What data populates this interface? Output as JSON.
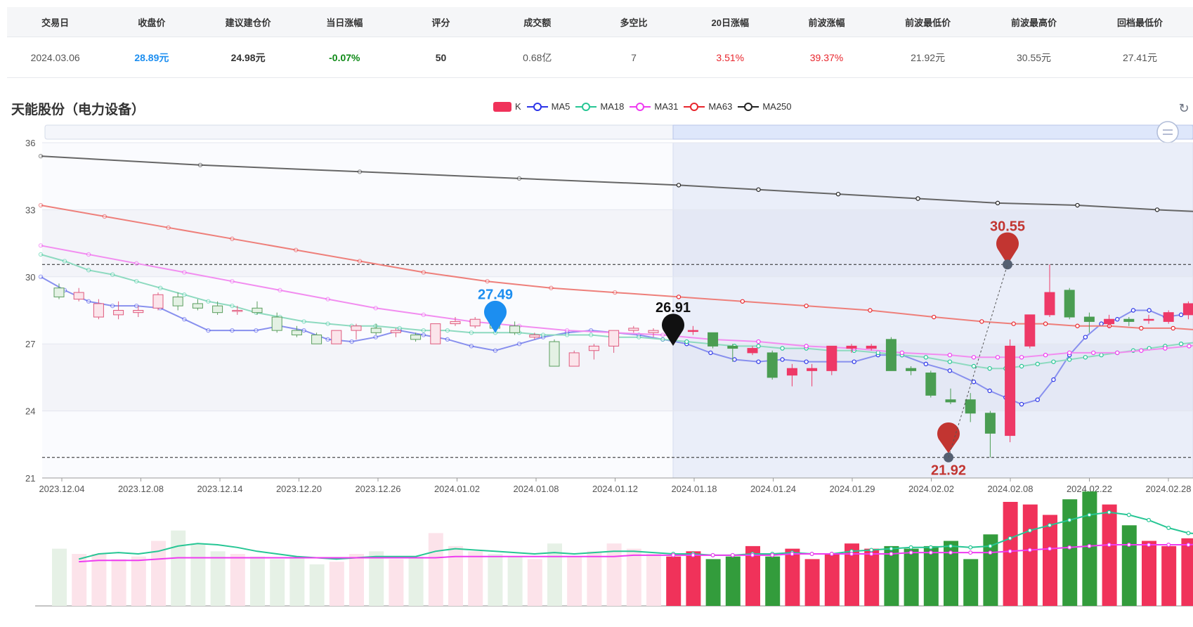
{
  "stats": {
    "headers": [
      "交易日",
      "收盘价",
      "建议建仓价",
      "当日涨幅",
      "评分",
      "成交额",
      "多空比",
      "20日涨幅",
      "前波涨幅",
      "前波最低价",
      "前波最高价",
      "回档最低价"
    ],
    "values": [
      "2024.03.06",
      "28.89元",
      "24.98元",
      "-0.07%",
      "50",
      "0.68亿",
      "7",
      "3.51%",
      "39.37%",
      "21.92元",
      "30.55元",
      "27.41元"
    ],
    "colors": [
      "#555555",
      "#1c8ef0",
      "#333333",
      "#0f8a17",
      "#333333",
      "#555555",
      "#555555",
      "#e8262d",
      "#e8262d",
      "#555555",
      "#555555",
      "#555555"
    ],
    "bold": [
      false,
      true,
      true,
      true,
      true,
      false,
      false,
      false,
      false,
      false,
      false,
      false
    ]
  },
  "chart_title": "天能股份（电力设备）",
  "legend": [
    {
      "name": "K",
      "color": "#f0325a",
      "type": "rect"
    },
    {
      "name": "MA5",
      "color": "#2b34e8",
      "type": "line"
    },
    {
      "name": "MA18",
      "color": "#26c694",
      "type": "line"
    },
    {
      "name": "MA31",
      "color": "#ee3cf0",
      "type": "line"
    },
    {
      "name": "MA63",
      "color": "#e8262d",
      "type": "line"
    },
    {
      "name": "MA250",
      "color": "#222222",
      "type": "line"
    }
  ],
  "chart_data": {
    "type": "candlestick",
    "title": "天能股份（电力设备）",
    "ylim": [
      21,
      36
    ],
    "yticks": [
      36,
      33,
      30,
      27,
      24,
      21
    ],
    "xtick_labels": [
      "2023.12.04",
      "2023.12.08",
      "2023.12.14",
      "2023.12.20",
      "2023.12.26",
      "2024.01.02",
      "2024.01.08",
      "2024.01.12",
      "2024.01.18",
      "2024.01.24",
      "2024.01.29",
      "2024.02.02",
      "2024.02.08",
      "2024.02.22",
      "2024.02.28"
    ],
    "candles": [
      [
        29.5,
        29.1,
        29.7,
        29.0
      ],
      [
        29.0,
        29.3,
        29.5,
        28.9
      ],
      [
        28.2,
        28.8,
        29.0,
        28.1
      ],
      [
        28.3,
        28.5,
        28.9,
        28.1
      ],
      [
        28.4,
        28.5,
        28.7,
        28.2
      ],
      [
        28.6,
        29.2,
        29.3,
        28.5
      ],
      [
        29.1,
        28.7,
        29.3,
        28.5
      ],
      [
        28.8,
        28.6,
        29.0,
        28.5
      ],
      [
        28.7,
        28.4,
        28.9,
        28.3
      ],
      [
        28.5,
        28.5,
        28.7,
        28.3
      ],
      [
        28.6,
        28.4,
        28.9,
        28.3
      ],
      [
        28.2,
        27.6,
        28.4,
        27.5
      ],
      [
        27.6,
        27.4,
        27.8,
        27.3
      ],
      [
        27.4,
        27.0,
        27.5,
        27.0
      ],
      [
        27.0,
        27.6,
        27.6,
        27.0
      ],
      [
        27.6,
        27.8,
        27.9,
        27.2
      ],
      [
        27.7,
        27.5,
        27.9,
        27.4
      ],
      [
        27.5,
        27.6,
        27.7,
        27.3
      ],
      [
        27.4,
        27.2,
        27.5,
        27.1
      ],
      [
        27.0,
        27.9,
        27.9,
        27.0
      ],
      [
        27.9,
        28.0,
        28.2,
        27.8
      ],
      [
        27.8,
        28.1,
        28.2,
        27.7
      ],
      [
        27.9,
        27.7,
        28.1,
        27.6
      ],
      [
        27.8,
        27.5,
        28.0,
        27.4
      ],
      [
        27.3,
        27.4,
        27.5,
        27.2
      ],
      [
        27.1,
        26.0,
        27.2,
        26.0
      ],
      [
        26.0,
        26.6,
        26.7,
        26.0
      ],
      [
        26.7,
        26.9,
        27.0,
        26.3
      ],
      [
        26.9,
        27.6,
        27.6,
        26.6
      ],
      [
        27.6,
        27.7,
        27.8,
        27.5
      ],
      [
        27.5,
        27.6,
        27.7,
        27.3
      ],
      [
        27.4,
        27.5,
        27.6,
        27.3
      ],
      [
        27.6,
        27.6,
        27.8,
        27.4
      ],
      [
        27.5,
        26.9,
        27.5,
        26.8
      ],
      [
        26.9,
        26.8,
        27.0,
        26.2
      ],
      [
        26.6,
        26.8,
        26.9,
        26.5
      ],
      [
        26.6,
        25.5,
        26.7,
        25.4
      ],
      [
        25.6,
        25.9,
        26.1,
        25.1
      ],
      [
        25.8,
        25.9,
        26.1,
        25.1
      ],
      [
        25.8,
        26.9,
        26.9,
        25.6
      ],
      [
        26.8,
        26.9,
        27.0,
        26.6
      ],
      [
        26.8,
        26.9,
        27.0,
        26.7
      ],
      [
        27.2,
        25.8,
        27.3,
        25.8
      ],
      [
        25.9,
        25.8,
        26.0,
        25.6
      ],
      [
        25.7,
        24.7,
        25.8,
        24.6
      ],
      [
        24.5,
        24.4,
        25.0,
        24.3
      ],
      [
        24.5,
        23.9,
        24.8,
        23.5
      ],
      [
        23.9,
        23.0,
        24.0,
        21.92
      ],
      [
        22.9,
        26.9,
        27.2,
        22.6
      ],
      [
        26.9,
        28.3,
        28.3,
        26.8
      ],
      [
        28.3,
        29.3,
        30.55,
        28.2
      ],
      [
        29.4,
        28.2,
        29.5,
        28.1
      ],
      [
        28.2,
        28.0,
        28.4,
        27.5
      ],
      [
        27.9,
        28.1,
        28.3,
        27.7
      ],
      [
        28.1,
        28.0,
        28.2,
        27.8
      ],
      [
        28.1,
        28.1,
        28.3,
        27.9
      ],
      [
        28.0,
        28.4,
        28.5,
        27.9
      ],
      [
        28.3,
        28.8,
        28.9,
        28.1
      ],
      [
        28.8,
        28.0,
        29.4,
        27.9
      ],
      [
        28.0,
        29.2,
        29.3,
        27.9
      ]
    ],
    "ma": {
      "MA5": [
        [
          0,
          30.0
        ],
        [
          3,
          29.4
        ],
        [
          6,
          28.9
        ],
        [
          9,
          28.7
        ],
        [
          12,
          28.7
        ],
        [
          15,
          28.6
        ],
        [
          18,
          28.1
        ],
        [
          21,
          27.6
        ],
        [
          24,
          27.6
        ],
        [
          27,
          27.6
        ],
        [
          30,
          27.8
        ],
        [
          33,
          27.6
        ],
        [
          36,
          27.2
        ],
        [
          39,
          27.1
        ],
        [
          42,
          27.3
        ],
        [
          45,
          27.6
        ],
        [
          48,
          27.4
        ],
        [
          51,
          27.2
        ],
        [
          54,
          26.9
        ],
        [
          57,
          26.7
        ],
        [
          60,
          27.0
        ],
        [
          63,
          27.3
        ],
        [
          66,
          27.5
        ],
        [
          69,
          27.6
        ],
        [
          72,
          27.5
        ],
        [
          75,
          27.4
        ],
        [
          78,
          27.2
        ],
        [
          81,
          27.0
        ],
        [
          84,
          26.6
        ],
        [
          87,
          26.3
        ],
        [
          90,
          26.2
        ],
        [
          93,
          26.3
        ],
        [
          96,
          26.2
        ],
        [
          99,
          26.2
        ],
        [
          102,
          26.2
        ],
        [
          105,
          26.5
        ],
        [
          108,
          26.5
        ],
        [
          111,
          26.1
        ],
        [
          114,
          25.8
        ],
        [
          117,
          25.3
        ],
        [
          119,
          24.9
        ],
        [
          121,
          24.6
        ],
        [
          123,
          24.3
        ],
        [
          125,
          24.5
        ],
        [
          127,
          25.4
        ],
        [
          129,
          26.5
        ],
        [
          131,
          27.3
        ],
        [
          133,
          27.9
        ],
        [
          135,
          28.1
        ],
        [
          137,
          28.5
        ],
        [
          139,
          28.5
        ],
        [
          141,
          28.2
        ],
        [
          143,
          28.3
        ],
        [
          146,
          28.4
        ]
      ],
      "MA18": [
        [
          0,
          31.0
        ],
        [
          3,
          30.7
        ],
        [
          6,
          30.3
        ],
        [
          9,
          30.1
        ],
        [
          12,
          29.8
        ],
        [
          15,
          29.5
        ],
        [
          18,
          29.2
        ],
        [
          21,
          28.9
        ],
        [
          24,
          28.7
        ],
        [
          27,
          28.4
        ],
        [
          30,
          28.2
        ],
        [
          33,
          28.0
        ],
        [
          36,
          27.9
        ],
        [
          39,
          27.8
        ],
        [
          42,
          27.8
        ],
        [
          45,
          27.7
        ],
        [
          48,
          27.6
        ],
        [
          51,
          27.6
        ],
        [
          54,
          27.5
        ],
        [
          57,
          27.5
        ],
        [
          60,
          27.5
        ],
        [
          63,
          27.4
        ],
        [
          66,
          27.4
        ],
        [
          69,
          27.4
        ],
        [
          72,
          27.3
        ],
        [
          75,
          27.3
        ],
        [
          78,
          27.2
        ],
        [
          81,
          27.1
        ],
        [
          84,
          27.0
        ],
        [
          87,
          26.9
        ],
        [
          90,
          26.9
        ],
        [
          93,
          26.8
        ],
        [
          96,
          26.8
        ],
        [
          99,
          26.7
        ],
        [
          102,
          26.7
        ],
        [
          105,
          26.6
        ],
        [
          108,
          26.5
        ],
        [
          111,
          26.4
        ],
        [
          114,
          26.2
        ],
        [
          117,
          26.0
        ],
        [
          119,
          25.9
        ],
        [
          121,
          25.9
        ],
        [
          123,
          26.0
        ],
        [
          125,
          26.1
        ],
        [
          127,
          26.2
        ],
        [
          129,
          26.3
        ],
        [
          131,
          26.4
        ],
        [
          133,
          26.5
        ],
        [
          135,
          26.6
        ],
        [
          137,
          26.7
        ],
        [
          139,
          26.8
        ],
        [
          141,
          26.9
        ],
        [
          143,
          27.0
        ],
        [
          146,
          27.1
        ]
      ],
      "MA31": [
        [
          0,
          31.4
        ],
        [
          6,
          31.0
        ],
        [
          12,
          30.6
        ],
        [
          18,
          30.2
        ],
        [
          24,
          29.8
        ],
        [
          30,
          29.4
        ],
        [
          36,
          29.0
        ],
        [
          42,
          28.6
        ],
        [
          48,
          28.3
        ],
        [
          54,
          28.0
        ],
        [
          60,
          27.8
        ],
        [
          66,
          27.6
        ],
        [
          72,
          27.5
        ],
        [
          78,
          27.4
        ],
        [
          84,
          27.2
        ],
        [
          90,
          27.1
        ],
        [
          96,
          26.9
        ],
        [
          102,
          26.8
        ],
        [
          108,
          26.6
        ],
        [
          114,
          26.5
        ],
        [
          117,
          26.4
        ],
        [
          120,
          26.4
        ],
        [
          123,
          26.4
        ],
        [
          126,
          26.5
        ],
        [
          129,
          26.6
        ],
        [
          132,
          26.6
        ],
        [
          135,
          26.6
        ],
        [
          138,
          26.7
        ],
        [
          141,
          26.8
        ],
        [
          144,
          26.9
        ],
        [
          146,
          27.0
        ]
      ],
      "MA63": [
        [
          0,
          33.2
        ],
        [
          8,
          32.7
        ],
        [
          16,
          32.2
        ],
        [
          24,
          31.7
        ],
        [
          32,
          31.2
        ],
        [
          40,
          30.7
        ],
        [
          48,
          30.2
        ],
        [
          56,
          29.8
        ],
        [
          64,
          29.5
        ],
        [
          72,
          29.3
        ],
        [
          80,
          29.1
        ],
        [
          88,
          28.9
        ],
        [
          96,
          28.7
        ],
        [
          104,
          28.5
        ],
        [
          112,
          28.2
        ],
        [
          118,
          28.0
        ],
        [
          122,
          27.9
        ],
        [
          126,
          27.9
        ],
        [
          130,
          27.8
        ],
        [
          134,
          27.8
        ],
        [
          138,
          27.7
        ],
        [
          142,
          27.7
        ],
        [
          146,
          27.6
        ]
      ],
      "MA250": [
        [
          0,
          35.4
        ],
        [
          20,
          35.0
        ],
        [
          40,
          34.7
        ],
        [
          60,
          34.4
        ],
        [
          80,
          34.1
        ],
        [
          90,
          33.9
        ],
        [
          100,
          33.7
        ],
        [
          110,
          33.5
        ],
        [
          120,
          33.3
        ],
        [
          130,
          33.2
        ],
        [
          140,
          33.0
        ],
        [
          146,
          32.9
        ]
      ]
    },
    "markers": [
      {
        "label": "27.49",
        "value": 27.49,
        "color": "#1c8ef0"
      },
      {
        "label": "26.91",
        "value": 26.91,
        "color": "#111111"
      },
      {
        "label": "30.55",
        "value": 30.55,
        "color": "#c23531"
      },
      {
        "label": "21.92",
        "value": 21.92,
        "color": "#c23531"
      }
    ],
    "ref_lines": [
      30.55,
      21.92
    ],
    "volume": [
      44,
      40,
      40,
      36,
      38,
      50,
      58,
      48,
      42,
      40,
      38,
      36,
      38,
      32,
      34,
      40,
      42,
      36,
      38,
      56,
      46,
      42,
      40,
      38,
      36,
      48,
      38,
      42,
      48,
      44,
      40,
      38,
      42,
      36,
      38,
      46,
      38,
      44,
      36,
      40,
      48,
      44,
      46,
      44,
      46,
      50,
      36,
      55,
      80,
      78,
      70,
      82,
      88,
      78,
      62,
      50,
      46,
      52,
      54,
      70
    ],
    "volume_ma_a": [
      null,
      36,
      40,
      41,
      40,
      42,
      46,
      48,
      47,
      45,
      42,
      40,
      38,
      37,
      36,
      37,
      38,
      38,
      38,
      42,
      44,
      43,
      42,
      41,
      40,
      41,
      40,
      41,
      42,
      42,
      41,
      40,
      40,
      39,
      39,
      40,
      40,
      41,
      40,
      40,
      42,
      43,
      44,
      45,
      45,
      46,
      45,
      46,
      52,
      58,
      62,
      66,
      70,
      72,
      70,
      66,
      60,
      56,
      55,
      58
    ],
    "volume_ma_b": [
      null,
      34,
      35,
      35,
      35,
      36,
      37,
      37,
      37,
      37,
      37,
      37,
      37,
      37,
      37,
      37,
      37,
      37,
      37,
      37,
      38,
      38,
      38,
      38,
      38,
      38,
      38,
      38,
      38,
      39,
      39,
      39,
      39,
      39,
      39,
      39,
      39,
      40,
      40,
      40,
      40,
      40,
      40,
      41,
      41,
      41,
      41,
      41,
      42,
      43,
      44,
      45,
      46,
      47,
      47,
      47,
      47,
      47,
      48,
      48
    ]
  }
}
